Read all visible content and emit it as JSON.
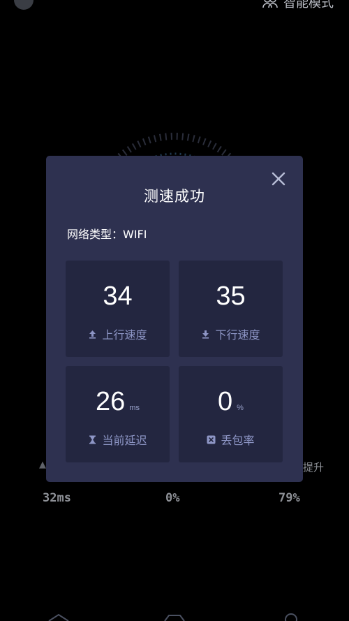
{
  "background": {
    "top_right_label": "智能模式",
    "stats": {
      "latency": "32ms",
      "loss": "0%",
      "boost": "79%"
    },
    "side_right_text": "提升"
  },
  "dialog": {
    "title": "测速成功",
    "network_label": "网络类型：",
    "network_value": "WIFI",
    "cards": {
      "upload": {
        "value": "34",
        "label": "上行速度",
        "icon": "upload-icon"
      },
      "download": {
        "value": "35",
        "label": "下行速度",
        "icon": "download-icon"
      },
      "latency": {
        "value": "26",
        "unit": "ms",
        "label": "当前延迟",
        "icon": "hourglass-icon"
      },
      "loss": {
        "value": "0",
        "unit": "%",
        "label": "丢包率",
        "icon": "close-box-icon"
      }
    }
  },
  "colors": {
    "dialog_bg": "#2e3150",
    "card_bg": "#232640",
    "accent_label": "#8e96c6"
  }
}
